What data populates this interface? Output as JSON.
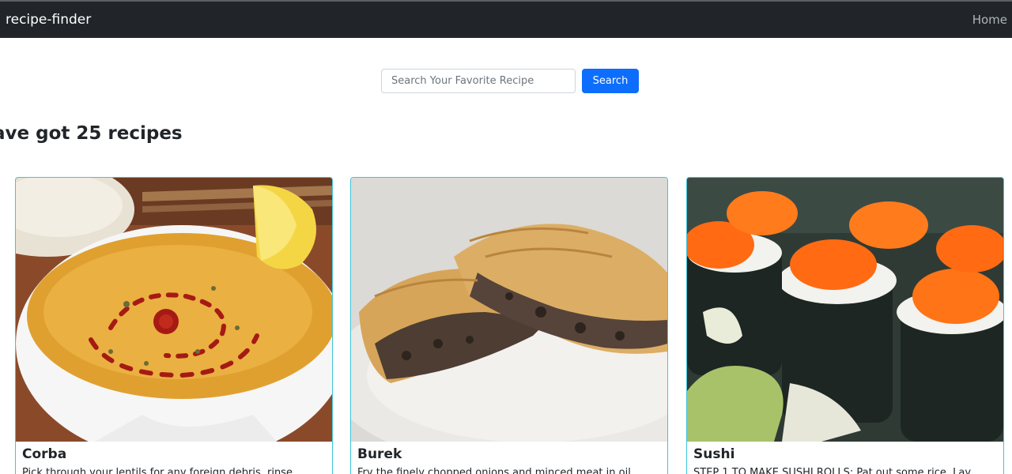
{
  "navbar": {
    "brand": "recipe-finder",
    "home_link": "Home"
  },
  "search": {
    "placeholder": "Search Your Favorite Recipe",
    "value": "",
    "button_label": "Search"
  },
  "results": {
    "heading": "ave got 25 recipes"
  },
  "recipes": [
    {
      "title": "Corba",
      "description": "Pick through your lentils for any foreign debris, rinse",
      "image": "soup-bowl-image"
    },
    {
      "title": "Burek",
      "description": "Fry the finely chopped onions and minced meat in oil",
      "image": "burek-pastry-image"
    },
    {
      "title": "Sushi",
      "description": "STEP 1 TO MAKE SUSHI ROLLS: Pat out some rice. Lay",
      "image": "sushi-rolls-image"
    }
  ],
  "colors": {
    "navbar_bg": "#212529",
    "accent_blue": "#0d6efd",
    "card_border": "#3fc5d9"
  }
}
